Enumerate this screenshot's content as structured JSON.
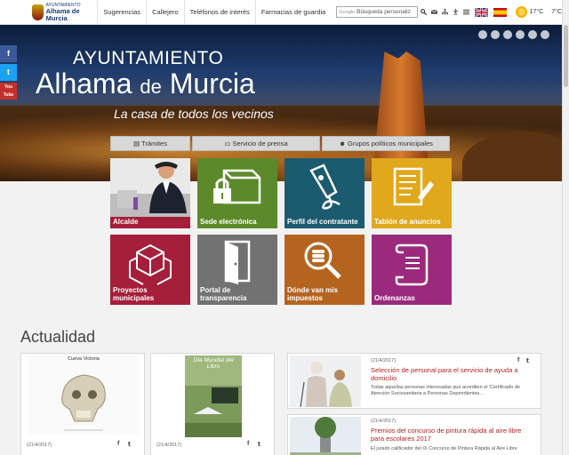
{
  "topbar": {
    "logo_small": "AYUNTAMIENTO",
    "logo_big": "Alhama de Murcia",
    "nav": [
      "Sugerencias",
      "Callejero",
      "Teléfonos de interés",
      "Farmacias de guardia"
    ],
    "search_brand": "Google",
    "search_placeholder": "Búsqueda personaliz",
    "temp_high": "17°C",
    "temp_low": "7°C"
  },
  "hero": {
    "line1": "AYUNTAMIENTO",
    "line2a": "Alhama",
    "line2b": "de",
    "line2c": "Murcia",
    "tagline": "La casa de todos los vecinos"
  },
  "social": [
    "f",
    "t",
    "You Tube"
  ],
  "subnav": [
    "Trámites",
    "Servicio de prensa",
    "Grupos políticos municipales"
  ],
  "tiles": [
    {
      "label": "Alcalde",
      "color": "#a51e3a"
    },
    {
      "label": "Sede electrónica",
      "color": "#5c8a2a"
    },
    {
      "label": "Perfil del contratante",
      "color": "#1a5b70"
    },
    {
      "label": "Tablón de anuncios",
      "color": "#e0a81c"
    },
    {
      "label": "Proyectos municipales",
      "color": "#a51e3a"
    },
    {
      "label": "Portal de transparencia",
      "color": "#727272"
    },
    {
      "label": "Dónde van mis impuestos",
      "color": "#b5641f"
    },
    {
      "label": "Ordenanzas",
      "color": "#9b2a7c"
    }
  ],
  "actualidad": {
    "title": "Actualidad",
    "left_cards": [
      {
        "date": "(21/4/2017)",
        "poster_title": "Cueva Victoria"
      },
      {
        "date": "(21/4/2017)",
        "poster_title": "Día Mundial del Libro"
      }
    ],
    "news": [
      {
        "date": "(21/4/2017)",
        "title": "Selección de personal para el servicio de ayuda a domicilio",
        "body": "Todas aquellas personas interesadas que acrediten el 'Certificado de Atención Sociosanitaria a Personas Dependientes..."
      },
      {
        "date": "(21/4/2017)",
        "title": "Premios del concurso de pintura rápida al aire libre para escolares 2017",
        "body": "El jurado calificador del IX Concurso de Pintura Rápida al Aire Libre"
      }
    ]
  }
}
